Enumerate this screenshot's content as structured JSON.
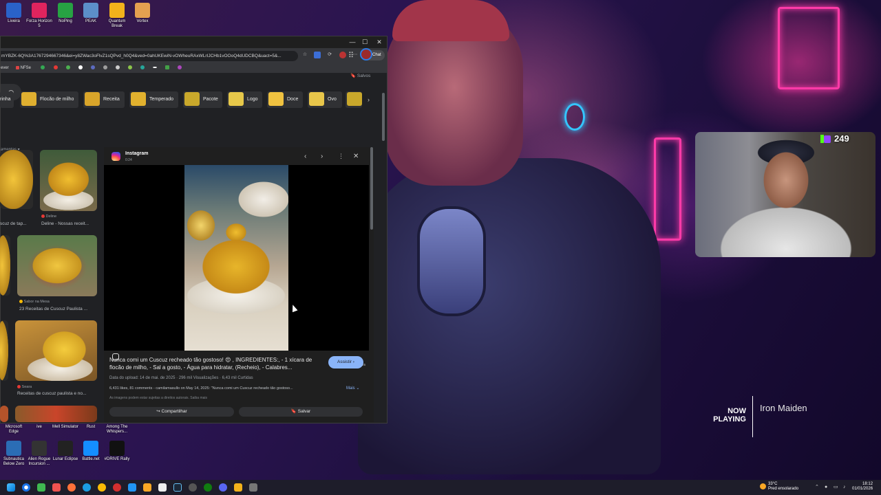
{
  "desktop_icons_top": [
    {
      "label": "Liveira",
      "color": "#2a62c9"
    },
    {
      "label": "Forza Horizon 5",
      "color": "#e0245e"
    },
    {
      "label": "NoPing",
      "color": "#27a243"
    },
    {
      "label": "PEAK",
      "color": "#5c8fc9"
    },
    {
      "label": "Quantum Break",
      "color": "#f2b21b"
    },
    {
      "label": "Vortex",
      "color": "#e4a050"
    }
  ],
  "desktop_icons_bottom": [
    {
      "label": "Microsoft Edge",
      "color": "#1b7fd6"
    },
    {
      "label": "ive",
      "color": "#333"
    },
    {
      "label": "Mell Simulator",
      "color": "#555"
    },
    {
      "label": "Rust",
      "color": "#b5462c"
    },
    {
      "label": "Among The Whispers...",
      "color": "#444"
    }
  ],
  "desktop_icons_bottom2": [
    {
      "label": "Subnautica Below Zero",
      "color": "#2b6db5"
    },
    {
      "label": "Alien Rogue Incursion ...",
      "color": "#333"
    },
    {
      "label": "Lunar Eclipse",
      "color": "#222"
    },
    {
      "label": "Battle.net",
      "color": "#148eff"
    },
    {
      "label": "#DRIVE Rally",
      "color": "#111"
    }
  ],
  "browser": {
    "url": "mYBZK-6Q%3A1767294667346&ei=y8ZWac3oFlvZ1sQPvd_h0Q4&ved=0ahUKEwiN-vOWheuRAxWLrIJCHb1vOOoQ4dUDCBQ&uact=5&...",
    "chat_label": "Chat",
    "bookmarks": [
      "ever",
      "NFSe"
    ],
    "tools_label": "amentas",
    "saved_label": "Salvos",
    "chips": [
      {
        "label": "rinha",
        "color": ""
      },
      {
        "label": "Flocão de milho",
        "color": "#e0b030"
      },
      {
        "label": "Receita",
        "color": "#d9a52a"
      },
      {
        "label": "Temperado",
        "color": "#e2b12e"
      },
      {
        "label": "Pacote",
        "color": "#c9a82b"
      },
      {
        "label": "Logo",
        "color": "#e7c84a"
      },
      {
        "label": "Doce",
        "color": "#f0c240"
      },
      {
        "label": "Ovo",
        "color": "#e8c64a"
      }
    ],
    "grid": [
      {
        "label": "scuz de tap...",
        "source": ""
      },
      {
        "label": "Deline - Nossas receit...",
        "source": "Deline"
      },
      {
        "label": "23 Receitas de Cuscuz Paulista ...",
        "source": "Sabor na Mesa"
      },
      {
        "label": "Receitas de cuscuz paulista e no...",
        "source": "Seara"
      }
    ],
    "panel": {
      "source_name": "Instagram",
      "source_time": "0:24",
      "image_dims": "464 × 825",
      "caption": "Nunca comi um Cuscuz recheado tão gostoso! 😍 , INGREDIENTES:, - 1 xícara de flocão de milho, - Sal a gosto, - Água para hidratar, (Recheio), - Calabres...",
      "watch_label": "Assistir",
      "meta": "Data do upload: 14 de mai. de 2025 · 296 mil Visualizações · 6,43 mil Curtidas",
      "stats": "6,431 likes, 81 comments - camilamasullo on May 14, 2025: \"Nunca comi um Cuscuz recheado tão gostoso...",
      "more_label": "Mais",
      "copyright": "As imagens podem estar sujeitas a direitos autorais.  Saiba mais",
      "share_label": "Compartilhar",
      "save_label": "Salvar"
    }
  },
  "stream": {
    "viewers": "249",
    "now_playing_label": "NOW PLAYING",
    "track": "Iron Maiden"
  },
  "taskbar": {
    "weather_temp": "33°C",
    "weather_desc": "Pred ensolarado",
    "time": "18:12",
    "date": "01/01/2026"
  }
}
